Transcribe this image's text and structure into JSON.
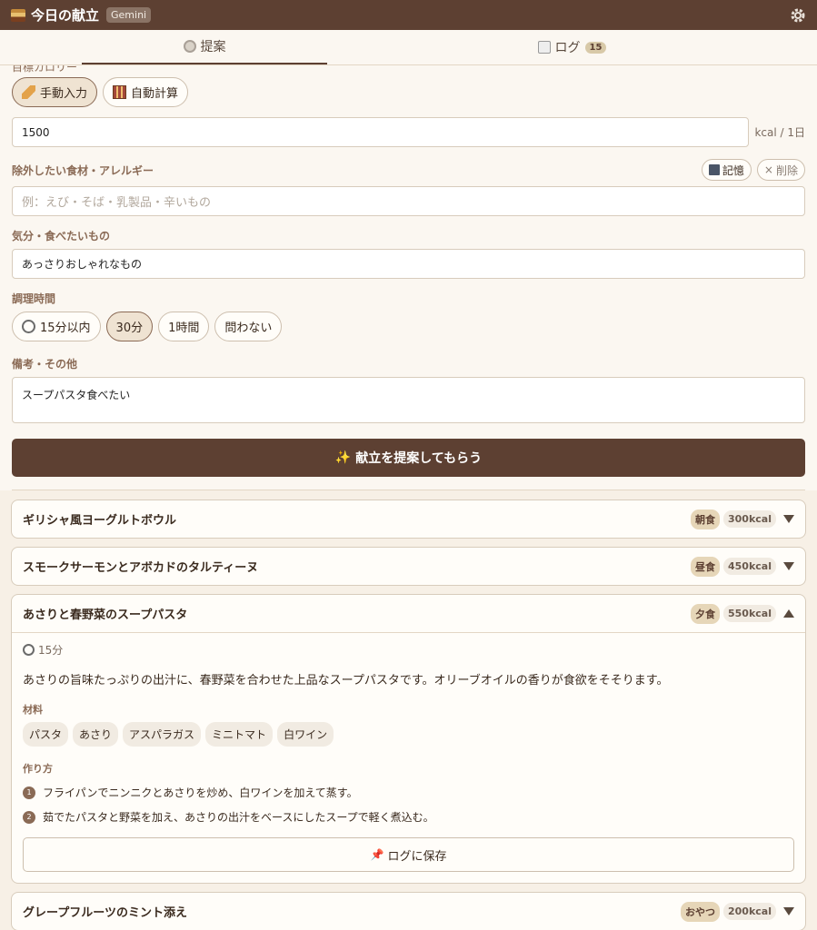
{
  "app": {
    "title": "今日の献立",
    "model_badge": "Gemini"
  },
  "tabs": [
    {
      "label": "提案"
    },
    {
      "label": "ログ",
      "count": "15"
    }
  ],
  "form": {
    "target_label_clipped": "目標カロリー",
    "calorie_modes": [
      "手動入力",
      "自動計算"
    ],
    "calorie_value": "1500",
    "calorie_unit": "kcal / 1日",
    "exclude_label": "除外したい食材・アレルギー",
    "exclude_save": "記憶",
    "exclude_delete": "削除",
    "exclude_placeholder": "例：えび・そば・乳製品・辛いもの",
    "mood_label": "気分・食べたいもの",
    "mood_value": "あっさりおしゃれなもの",
    "time_label": "調理時間",
    "time_options": [
      "15分以内",
      "30分",
      "1時間",
      "問わない"
    ],
    "notes_label": "備考・その他",
    "notes_value": "スープパスタ食べたい",
    "submit_label": "献立を提案してもらう",
    "submit_sparkle": "✨"
  },
  "meals": [
    {
      "title": "ギリシャ風ヨーグルトボウル",
      "meal": "朝食",
      "kcal": "300kcal"
    },
    {
      "title": "スモークサーモンとアボカドのタルティーヌ",
      "meal": "昼食",
      "kcal": "450kcal"
    },
    {
      "title": "あさりと春野菜のスープパスタ",
      "meal": "夕食",
      "kcal": "550kcal",
      "time": "15分",
      "desc": "あさりの旨味たっぷりの出汁に、春野菜を合わせた上品なスープパスタです。オリーブオイルの香りが食欲をそそります。",
      "ingredients_label": "材料",
      "ingredients": [
        "パスタ",
        "あさり",
        "アスパラガス",
        "ミニトマト",
        "白ワイン"
      ],
      "steps_label": "作り方",
      "steps": [
        "フライパンでニンニクとあさりを炒め、白ワインを加えて蒸す。",
        "茹でたパスタと野菜を加え、あさりの出汁をベースにしたスープで軽く煮込む。"
      ],
      "save_label": "ログに保存"
    },
    {
      "title": "グレープフルーツのミント添え",
      "meal": "おやつ",
      "kcal": "200kcal"
    }
  ],
  "colors": {
    "header": "#5d4032",
    "background": "#f7f0e6",
    "accent_pill": "#e6d6b8"
  }
}
